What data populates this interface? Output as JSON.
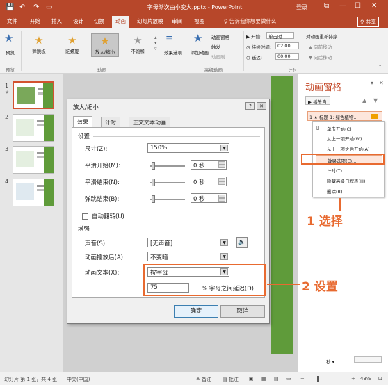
{
  "titlebar": {
    "title": "字母渐次由小变大.pptx - PowerPoint",
    "login": "登录",
    "save_icon": "💾",
    "undo_icon": "↶",
    "redo_icon": "↷",
    "present_icon": "▭",
    "min_icon": "—",
    "max_icon": "☐",
    "close_icon": "✕",
    "restore_icon": "⧉"
  },
  "tabs": [
    "文件",
    "开始",
    "插入",
    "设计",
    "切换",
    "动画",
    "幻灯片放映",
    "审阅",
    "视图"
  ],
  "active_tab": "动画",
  "tellme": "♀ 告诉我你想要做什么",
  "share": "♀ 共享",
  "ribbon": {
    "preview": "预览",
    "preview_group": "预览",
    "animations": [
      "弹跳板",
      "陀螺旋",
      "放大/缩小",
      "不饱和"
    ],
    "effect_options": "效果选项",
    "animation_group": "动画",
    "add_animation": "添加动画",
    "animation_pane": "动画窗格",
    "trigger": "触发",
    "painter": "动画刷",
    "advanced_group": "高级动画",
    "start_label": "▶ 开始:",
    "start_value": "单击时",
    "duration_label": "◷ 持续时间:",
    "duration_value": "02.00",
    "delay_label": "◷ 延迟:",
    "delay_value": "00.00",
    "reorder_title": "对动画重新排序",
    "move_earlier": "▲ 向前移动",
    "move_later": "▼ 向后移动",
    "timing_group": "计时"
  },
  "slides": [
    "1",
    "2",
    "3",
    "4"
  ],
  "slide_star": "★",
  "anim_pane": {
    "title": "动画窗格",
    "play": "▶ 播放自",
    "item": "1 ★ 标题 1: 绿色植物...",
    "menu": [
      "单击开始(C)",
      "从上一项开始(W)",
      "从上一项之后开始(A)",
      "效果选项(E)...",
      "计时(T)...",
      "隐藏高级日程表(H)",
      "删除(R)"
    ],
    "seconds": "秒 ▾"
  },
  "annotations": {
    "step1": "1 选择",
    "step2": "2 设置"
  },
  "dialog": {
    "title": "放大/缩小",
    "help": "?",
    "close": "✕",
    "tabs": [
      "效果",
      "计时",
      "正文文本动画"
    ],
    "settings_section": "设置",
    "size_label": "尺寸(Z):",
    "size_value": "150%",
    "smooth_start_label": "平滑开始(M):",
    "smooth_start_value": "0 秒",
    "smooth_end_label": "平滑结束(N):",
    "smooth_end_value": "0 秒",
    "bounce_end_label": "弹跳结束(B):",
    "bounce_end_value": "0 秒",
    "auto_reverse": "自动翻转(U)",
    "enhance_section": "增强",
    "sound_label": "声音(S):",
    "sound_value": "[无声音]",
    "after_anim_label": "动画播放后(A):",
    "after_anim_value": "不变暗",
    "anim_text_label": "动画文本(X):",
    "anim_text_value": "按字母",
    "delay_pct_value": "75",
    "delay_pct_label": "% 字母之间延迟(D)",
    "ok": "确定",
    "cancel": "取消",
    "speaker_icon": "🔈"
  },
  "status": {
    "slide_info": "幻灯片 第 1 张，共 4 张",
    "language": "中文(中国)",
    "notes": "≜ 备注",
    "comments": "▤ 批注",
    "zoom": "43%",
    "minus": "−",
    "plus": "+"
  }
}
